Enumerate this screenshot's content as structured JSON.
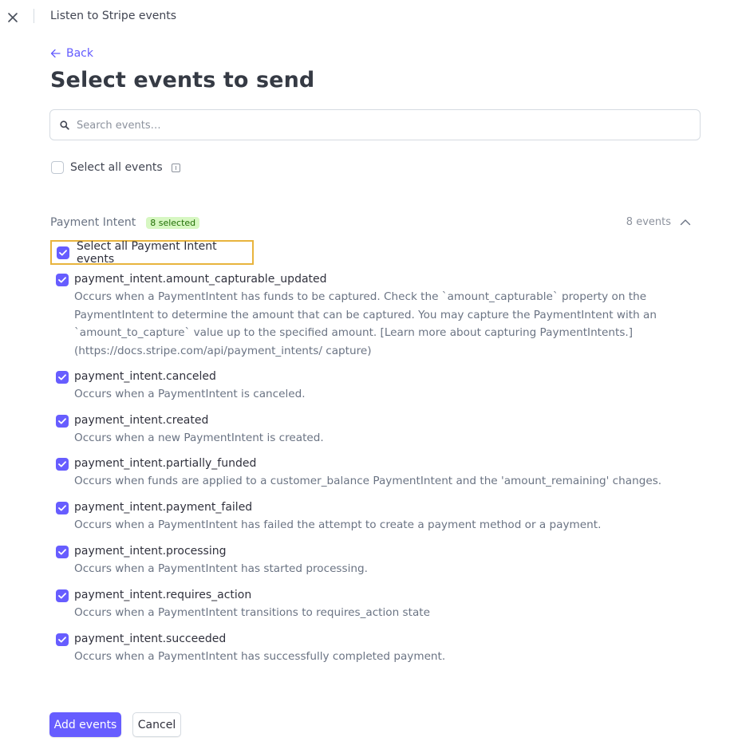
{
  "header": {
    "title": "Listen to Stripe events"
  },
  "nav": {
    "back_label": "Back"
  },
  "page": {
    "title": "Select events to send"
  },
  "search": {
    "placeholder": "Search events…",
    "value": ""
  },
  "select_all": {
    "label": "Select all events",
    "checked": false
  },
  "group": {
    "name": "Payment Intent",
    "badge": "8 selected",
    "count_label": "8 events",
    "expanded": true,
    "select_all_label": "Select all Payment Intent events",
    "select_all_checked": true,
    "events": [
      {
        "name": "payment_intent.amount_capturable_updated",
        "description": "Occurs when a PaymentIntent has funds to be captured. Check the `amount_capturable` property on the PaymentIntent to determine the amount that can be captured. You may capture the PaymentIntent with an `amount_to_capture` value up to the specified amount. [Learn more about capturing PaymentIntents.](https://docs.stripe.com/api/payment_intents/ capture)",
        "checked": true
      },
      {
        "name": "payment_intent.canceled",
        "description": "Occurs when a PaymentIntent is canceled.",
        "checked": true
      },
      {
        "name": "payment_intent.created",
        "description": "Occurs when a new PaymentIntent is created.",
        "checked": true
      },
      {
        "name": "payment_intent.partially_funded",
        "description": "Occurs when funds are applied to a customer_balance PaymentIntent and the 'amount_remaining' changes.",
        "checked": true
      },
      {
        "name": "payment_intent.payment_failed",
        "description": "Occurs when a PaymentIntent has failed the attempt to create a payment method or a payment.",
        "checked": true
      },
      {
        "name": "payment_intent.processing",
        "description": "Occurs when a PaymentIntent has started processing.",
        "checked": true
      },
      {
        "name": "payment_intent.requires_action",
        "description": "Occurs when a PaymentIntent transitions to requires_action state",
        "checked": true
      },
      {
        "name": "payment_intent.succeeded",
        "description": "Occurs when a PaymentIntent has successfully completed payment.",
        "checked": true
      }
    ]
  },
  "footer": {
    "primary_label": "Add events",
    "secondary_label": "Cancel"
  },
  "colors": {
    "accent": "#675dff",
    "highlight": "#e8b43d",
    "badge_bg": "#d7f7c2",
    "badge_text": "#217005"
  },
  "icons": {
    "close": "close-icon",
    "back": "arrow-left-icon",
    "search": "search-icon",
    "info": "info-icon",
    "collapse": "chevron-up-icon",
    "check": "check-icon"
  }
}
